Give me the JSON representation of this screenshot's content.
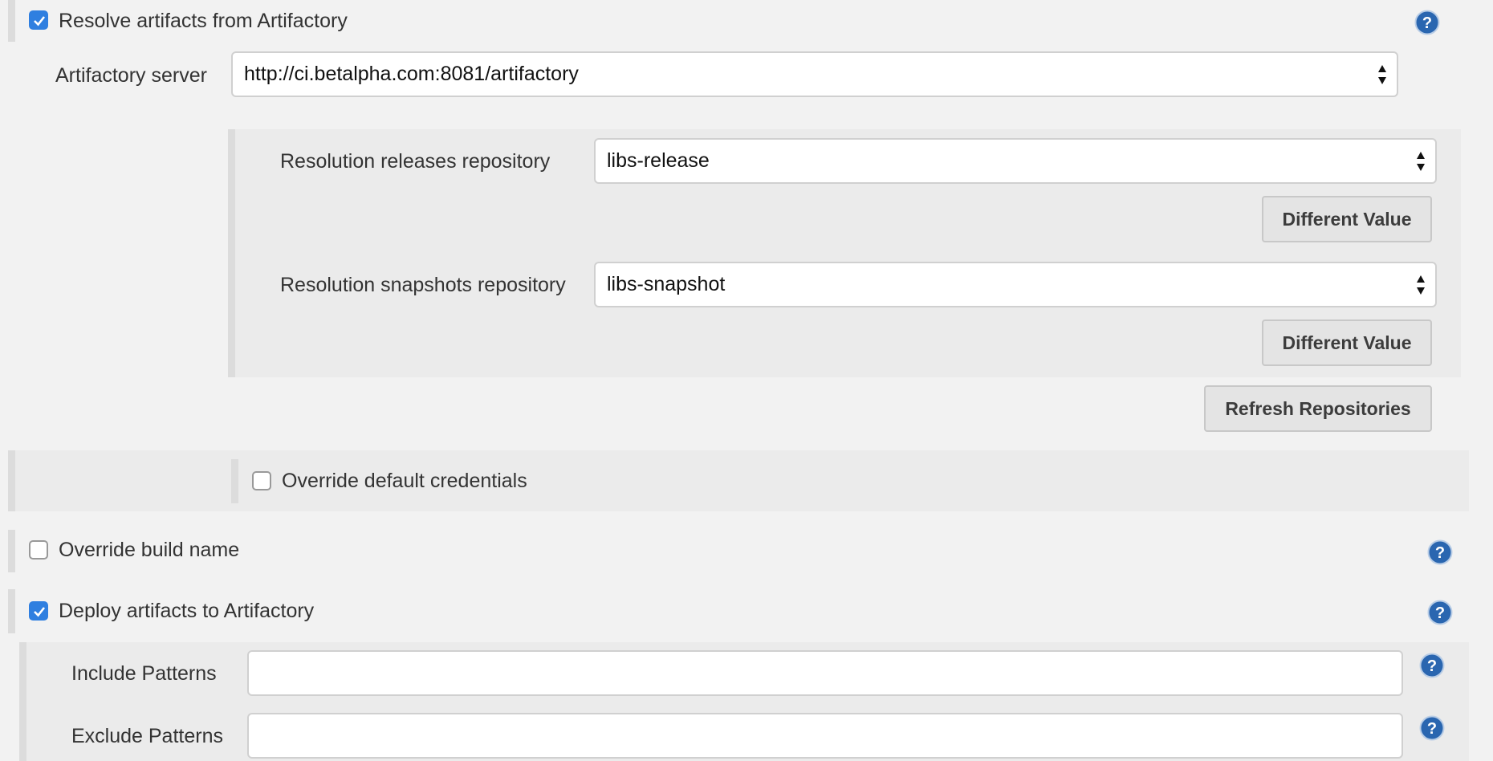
{
  "resolve": {
    "label": "Resolve artifacts from Artifactory",
    "checked": true,
    "server_label": "Artifactory server",
    "server_value": "http://ci.betalpha.com:8081/artifactory",
    "releases_label": "Resolution releases repository",
    "releases_value": "libs-release",
    "snapshots_label": "Resolution snapshots repository",
    "snapshots_value": "libs-snapshot",
    "different_value_label": "Different Value",
    "refresh_label": "Refresh Repositories",
    "override_credentials_label": "Override default credentials",
    "override_credentials_checked": false
  },
  "override_build_name": {
    "label": "Override build name",
    "checked": false
  },
  "deploy": {
    "label": "Deploy artifacts to Artifactory",
    "checked": true,
    "include_label": "Include Patterns",
    "include_value": "",
    "exclude_label": "Exclude Patterns",
    "exclude_value": ""
  },
  "colors": {
    "accent": "#2f7fe0",
    "help_icon": "#2a66b0",
    "background": "#f2f2f2",
    "panel": "#ebebeb"
  }
}
